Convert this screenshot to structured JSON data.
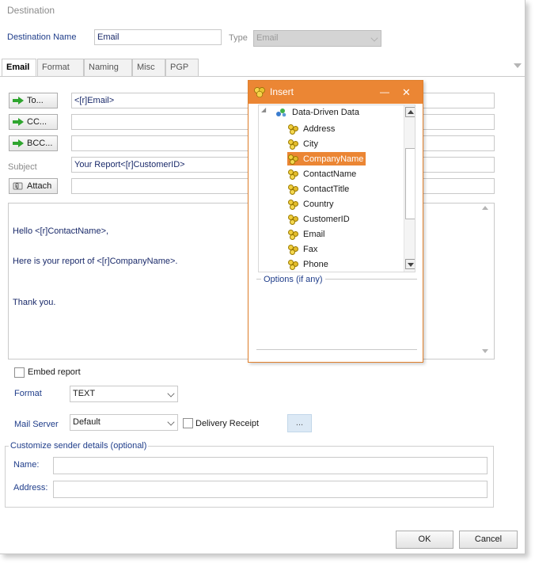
{
  "dialog": {
    "title": "Destination",
    "destination_name_label": "Destination Name",
    "destination_name_value": "Email",
    "type_label": "Type",
    "type_value": "Email"
  },
  "tabs": [
    {
      "label": "Email",
      "active": true
    },
    {
      "label": "Format",
      "active": false
    },
    {
      "label": "Naming",
      "active": false
    },
    {
      "label": "Misc",
      "active": false
    },
    {
      "label": "PGP",
      "active": false
    }
  ],
  "email": {
    "to_label": "To...",
    "to_value": "<[r]Email>",
    "cc_label": "CC...",
    "cc_value": "",
    "bcc_label": "BCC...",
    "bcc_value": "",
    "subject_label": "Subject",
    "subject_value": "Your Report<[r]CustomerID>",
    "attach_label": "Attach",
    "attach_value": "",
    "body_lines": [
      "Hello <[r]ContactName>,",
      "Here is your report of <[r]CompanyName>.",
      "Thank you."
    ],
    "embed_report_label": "Embed report",
    "embed_report_checked": false,
    "format_label": "Format",
    "format_value": "TEXT",
    "mail_server_label": "Mail Server",
    "mail_server_value": "Default",
    "delivery_receipt_label": "Delivery Receipt",
    "delivery_receipt_checked": false,
    "ellipsis_label": "..."
  },
  "sender": {
    "group_title": "Customize sender details (optional)",
    "name_label": "Name:",
    "name_value": "",
    "address_label": "Address:",
    "address_value": ""
  },
  "footer": {
    "ok_label": "OK",
    "cancel_label": "Cancel"
  },
  "insert_popup": {
    "title": "Insert",
    "minimize_glyph": "—",
    "close_glyph": "✕",
    "root_label": "Data-Driven Data",
    "expander_glyph": "◢",
    "items": [
      "Address",
      "City",
      "CompanyName",
      "ContactName",
      "ContactTitle",
      "Country",
      "CustomerID",
      "Email",
      "Fax",
      "Phone"
    ],
    "selected_item": "CompanyName",
    "options_label": "Options (if any)"
  },
  "colors": {
    "accent_orange": "#eb8634",
    "label_blue": "#1f3d8a",
    "arrow_green": "#2fa52f"
  },
  "icons": {
    "to_button": "green-arrow-icon",
    "cc_button": "green-arrow-icon",
    "bcc_button": "green-arrow-icon",
    "attach_button": "paperclip-icon",
    "tree_items": "puzzle-piece-icon",
    "tree_root": "database-icon"
  }
}
